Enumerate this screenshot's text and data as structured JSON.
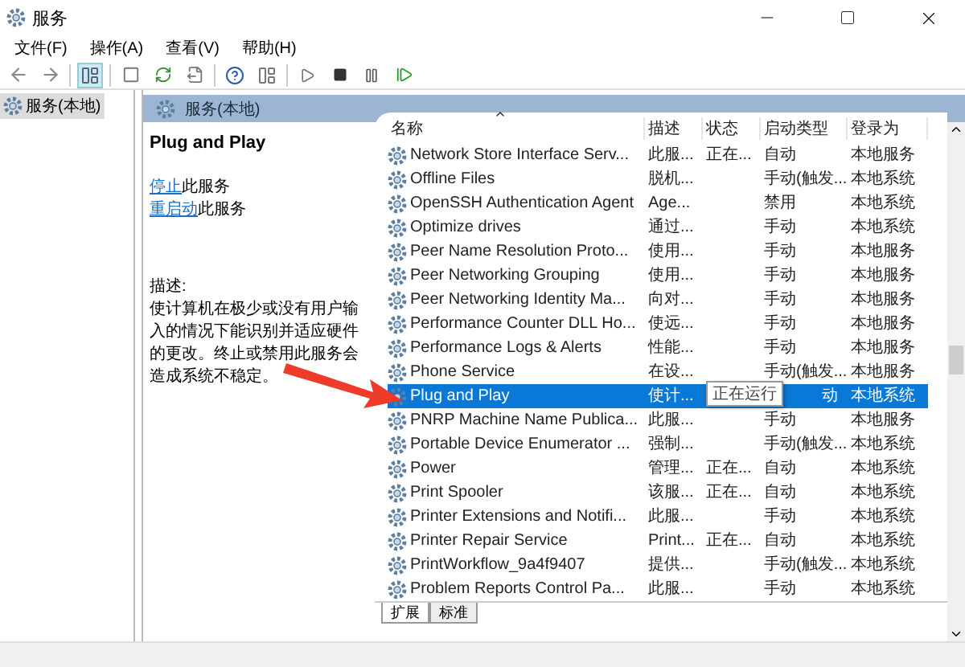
{
  "window": {
    "title": "服务"
  },
  "menu": [
    "文件(F)",
    "操作(A)",
    "查看(V)",
    "帮助(H)"
  ],
  "tree": [
    {
      "label": "服务(本地)",
      "selected": true
    }
  ],
  "panel": {
    "title": "服务(本地)"
  },
  "detail": {
    "service_name": "Plug and Play",
    "actions": [
      {
        "link": "停止",
        "text": "此服务"
      },
      {
        "link": "重启动",
        "text": "此服务"
      }
    ],
    "description_label": "描述:",
    "description": "使计算机在极少或没有用户输入的情况下能识别并适应硬件的更改。终止或禁用此服务会造成系统不稳定。"
  },
  "columns": [
    "名称",
    "描述",
    "状态",
    "启动类型",
    "登录为"
  ],
  "rows": [
    {
      "name": "Network Store Interface Serv...",
      "description": "此服...",
      "status": "正在...",
      "startup": "自动",
      "logon": "本地服务",
      "selected": false
    },
    {
      "name": "Offline Files",
      "description": "脱机...",
      "status": "",
      "startup": "手动(触发...",
      "logon": "本地系统",
      "selected": false
    },
    {
      "name": "OpenSSH Authentication Agent",
      "description": "Age...",
      "status": "",
      "startup": "禁用",
      "logon": "本地系统",
      "selected": false
    },
    {
      "name": "Optimize drives",
      "description": "通过...",
      "status": "",
      "startup": "手动",
      "logon": "本地系统",
      "selected": false
    },
    {
      "name": "Peer Name Resolution Proto...",
      "description": "使用...",
      "status": "",
      "startup": "手动",
      "logon": "本地服务",
      "selected": false
    },
    {
      "name": "Peer Networking Grouping",
      "description": "使用...",
      "status": "",
      "startup": "手动",
      "logon": "本地服务",
      "selected": false
    },
    {
      "name": "Peer Networking Identity Ma...",
      "description": "向对...",
      "status": "",
      "startup": "手动",
      "logon": "本地服务",
      "selected": false
    },
    {
      "name": "Performance Counter DLL Ho...",
      "description": "使远...",
      "status": "",
      "startup": "手动",
      "logon": "本地服务",
      "selected": false
    },
    {
      "name": "Performance Logs & Alerts",
      "description": "性能...",
      "status": "",
      "startup": "手动",
      "logon": "本地服务",
      "selected": false
    },
    {
      "name": "Phone Service",
      "description": "在设...",
      "status": "",
      "startup": "手动(触发...",
      "logon": "本地服务",
      "selected": false
    },
    {
      "name": "Plug and Play",
      "description": "使计...",
      "status": "",
      "startup": "动",
      "logon": "本地系统",
      "selected": true
    },
    {
      "name": "PNRP Machine Name Publica...",
      "description": "此服...",
      "status": "",
      "startup": "手动",
      "logon": "本地服务",
      "selected": false
    },
    {
      "name": "Portable Device Enumerator ...",
      "description": "强制...",
      "status": "",
      "startup": "手动(触发...",
      "logon": "本地系统",
      "selected": false
    },
    {
      "name": "Power",
      "description": "管理...",
      "status": "正在...",
      "startup": "自动",
      "logon": "本地系统",
      "selected": false
    },
    {
      "name": "Print Spooler",
      "description": "该服...",
      "status": "正在...",
      "startup": "自动",
      "logon": "本地系统",
      "selected": false
    },
    {
      "name": "Printer Extensions and Notifi...",
      "description": "此服...",
      "status": "",
      "startup": "手动",
      "logon": "本地系统",
      "selected": false
    },
    {
      "name": "Printer Repair Service",
      "description": "Print...",
      "status": "正在...",
      "startup": "自动",
      "logon": "本地系统",
      "selected": false
    },
    {
      "name": "PrintWorkflow_9a4f9407",
      "description": "提供...",
      "status": "",
      "startup": "手动(触发...",
      "logon": "本地系统",
      "selected": false
    },
    {
      "name": "Problem Reports Control Pa...",
      "description": "此服...",
      "status": "",
      "startup": "手动",
      "logon": "本地系统",
      "selected": false
    }
  ],
  "tooltip": "正在运行",
  "bottom_tabs": [
    {
      "label": "扩展",
      "selected": true
    },
    {
      "label": "标准",
      "selected": false
    }
  ]
}
